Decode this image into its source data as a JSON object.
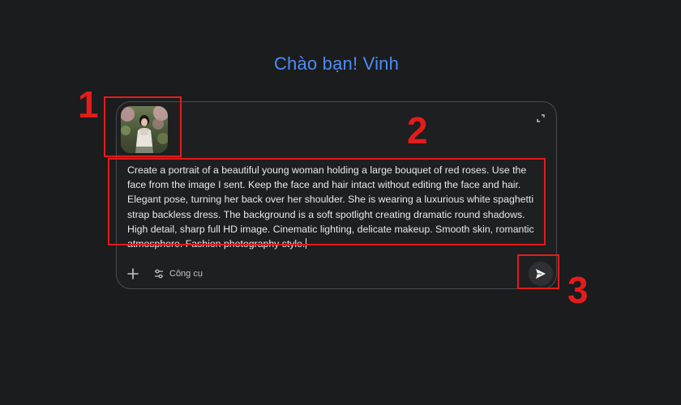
{
  "greeting": "Chào bạn! Vinh",
  "composer": {
    "attached_image_alt": "attached-portrait-thumbnail",
    "prompt_text": "Create a portrait of a beautiful young woman holding a large bouquet of red roses. Use the face from the image I sent. Keep the face and hair intact without editing the face and hair. Elegant pose, turning her back over her shoulder. She is wearing a luxurious white spaghetti strap backless dress. The background is a soft spotlight creating dramatic round shadows. High detail, sharp full HD image. Cinematic lighting, delicate makeup. Smooth skin, romantic atmosphere. Fashion photography style.",
    "tools_label": "Công cụ",
    "icons": {
      "expand": "expand-icon",
      "add": "plus-icon",
      "tools": "tune-icon",
      "send": "send-icon"
    }
  },
  "annotations": {
    "label_1": "1",
    "label_2": "2",
    "label_3": "3",
    "color": "#e31c1c"
  },
  "colors": {
    "background": "#1b1c1d",
    "greeting": "#4c8df6",
    "composer_border": "#4a4c50"
  }
}
